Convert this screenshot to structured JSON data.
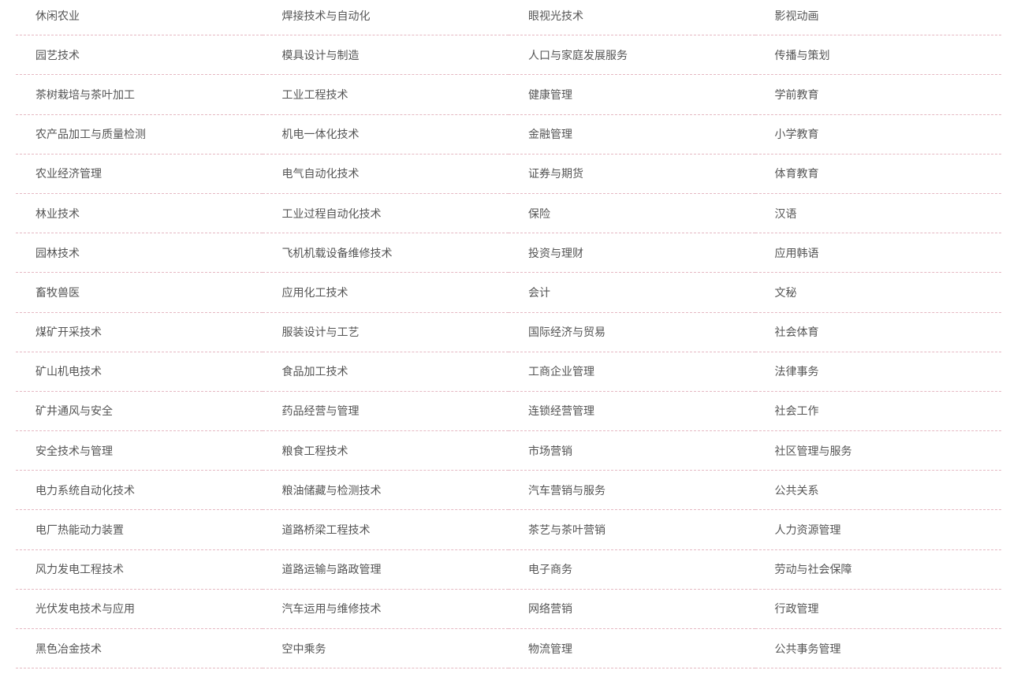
{
  "majors": [
    "休闲农业",
    "焊接技术与自动化",
    "眼视光技术",
    "影视动画",
    "园艺技术",
    "模具设计与制造",
    "人口与家庭发展服务",
    "传播与策划",
    "茶树栽培与茶叶加工",
    "工业工程技术",
    "健康管理",
    "学前教育",
    "农产品加工与质量检测",
    "机电一体化技术",
    "金融管理",
    "小学教育",
    "农业经济管理",
    "电气自动化技术",
    "证券与期货",
    "体育教育",
    "林业技术",
    "工业过程自动化技术",
    "保险",
    "汉语",
    "园林技术",
    "飞机机载设备维修技术",
    "投资与理财",
    "应用韩语",
    "畜牧兽医",
    "应用化工技术",
    "会计",
    "文秘",
    "煤矿开采技术",
    "服装设计与工艺",
    "国际经济与贸易",
    "社会体育",
    "矿山机电技术",
    "食品加工技术",
    "工商企业管理",
    "法律事务",
    "矿井通风与安全",
    "药品经营与管理",
    "连锁经营管理",
    "社会工作",
    "安全技术与管理",
    "粮食工程技术",
    "市场营销",
    "社区管理与服务",
    "电力系统自动化技术",
    "粮油储藏与检测技术",
    "汽车营销与服务",
    "公共关系",
    "电厂热能动力装置",
    "道路桥梁工程技术",
    "茶艺与茶叶营销",
    "人力资源管理",
    "风力发电工程技术",
    "道路运输与路政管理",
    "电子商务",
    "劳动与社会保障",
    "光伏发电技术与应用",
    "汽车运用与维修技术",
    "网络营销",
    "行政管理",
    "黑色冶金技术",
    "空中乘务",
    "物流管理",
    "公共事务管理"
  ]
}
